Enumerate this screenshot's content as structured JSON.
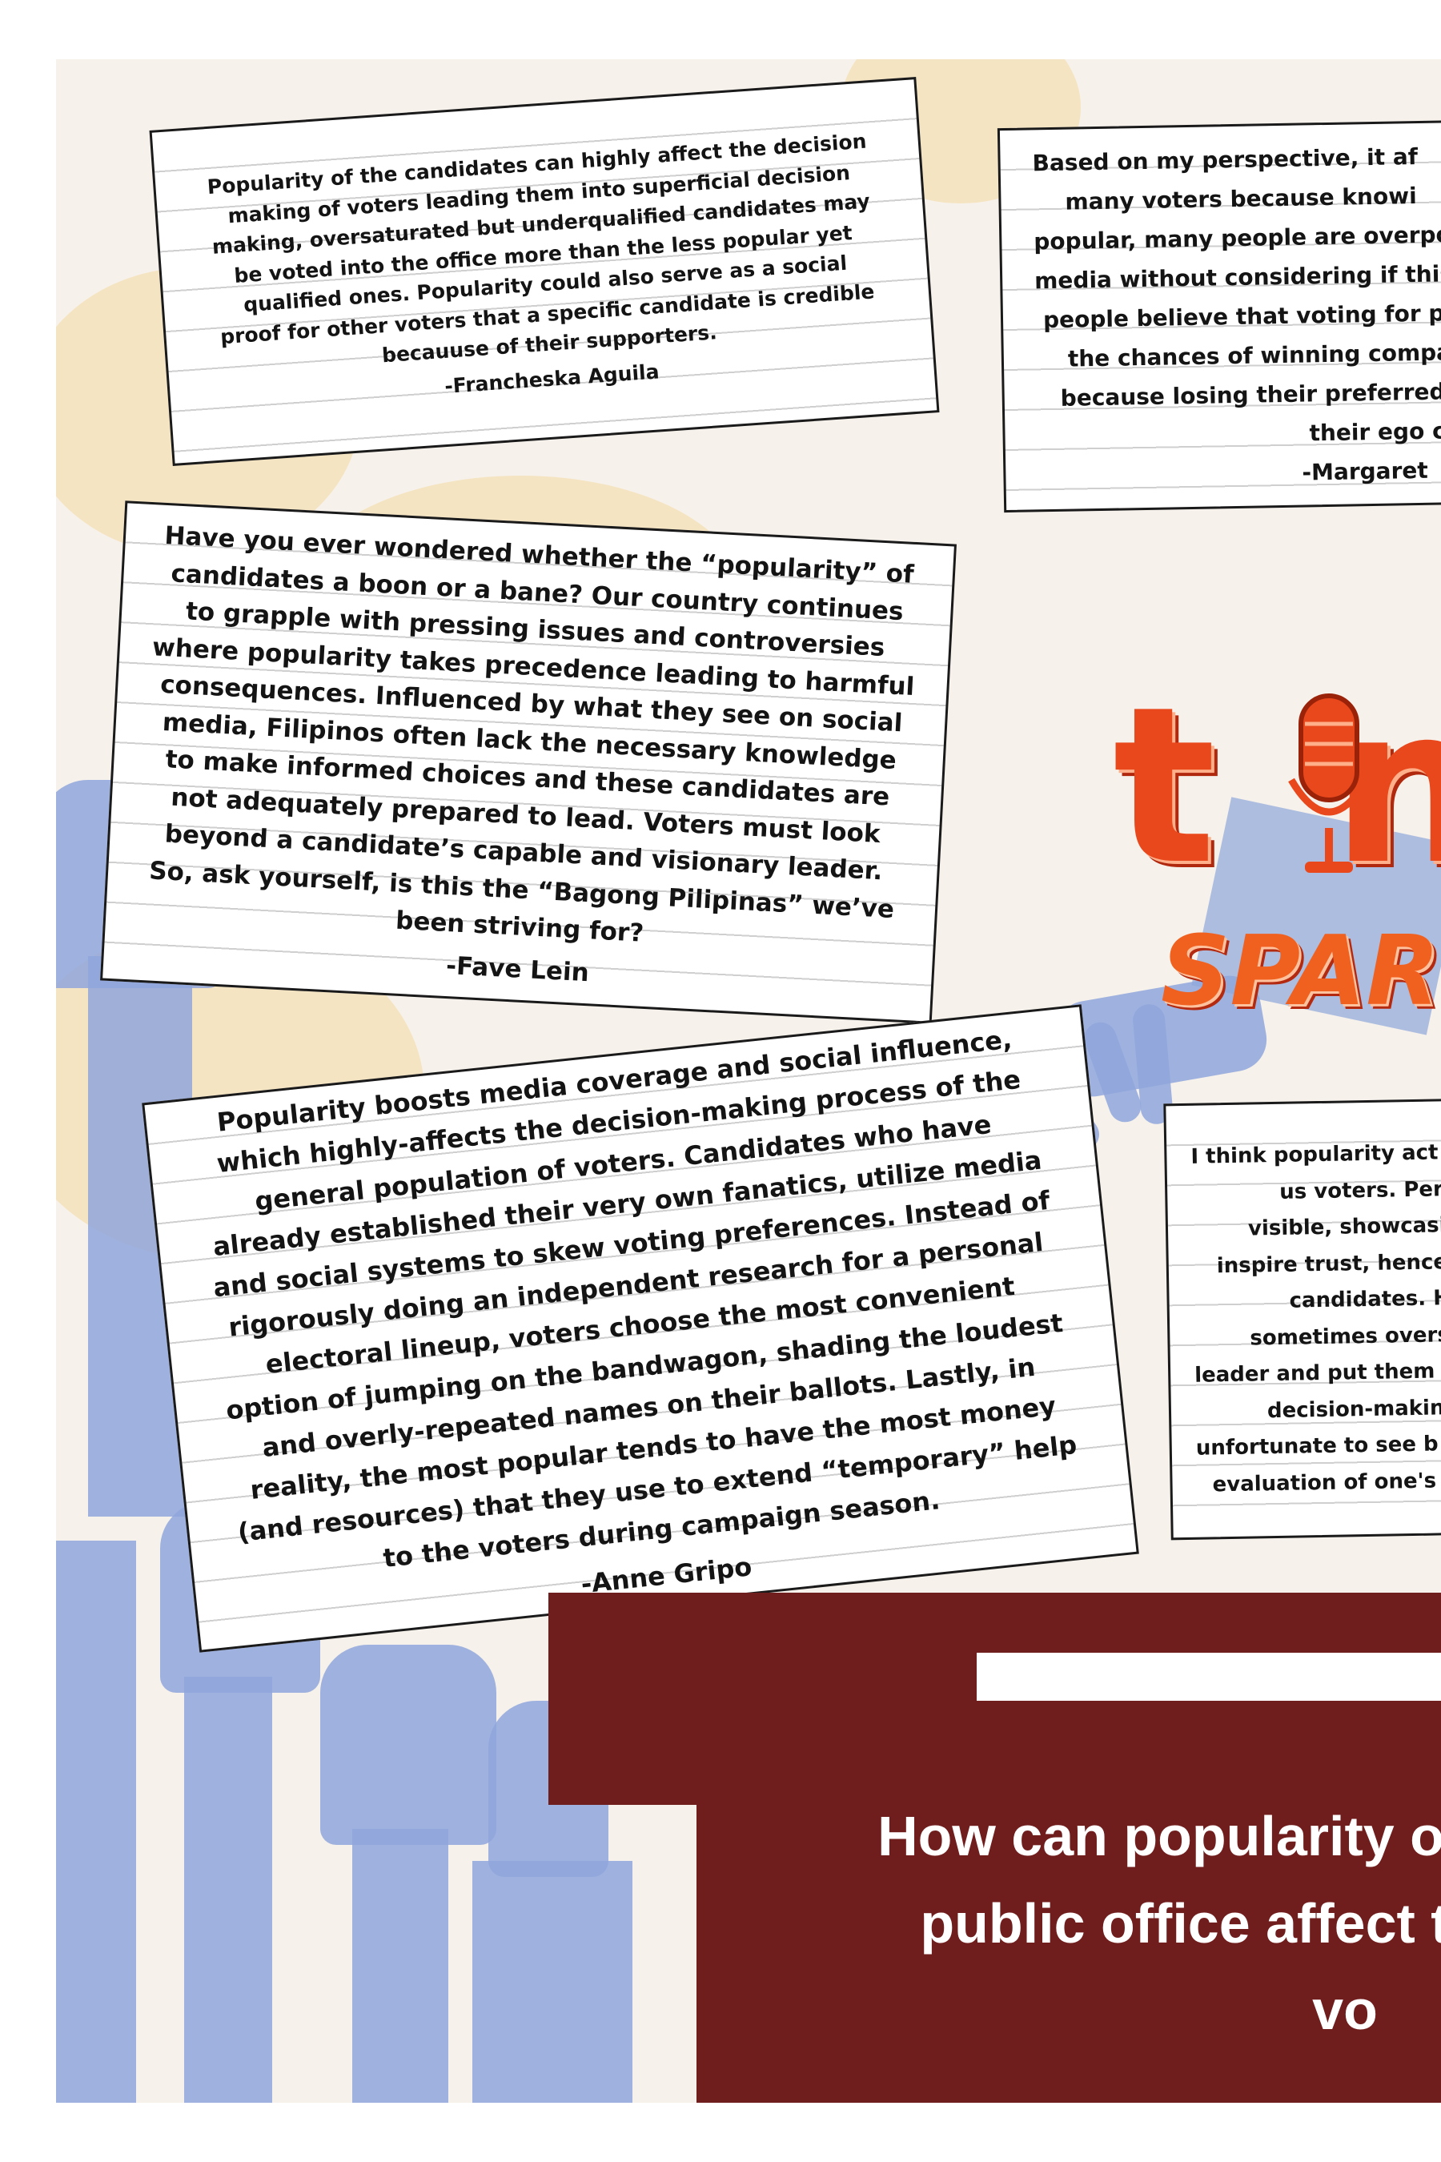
{
  "colors": {
    "background": "#f6f1ea",
    "cloud": "#f5e2bd",
    "hands": "#8fa6dc",
    "banner": "#6f1e1d",
    "logo": "#e8481c"
  },
  "cards": {
    "aguila": {
      "text": "Popularity of the candidates can highly affect the decision making of voters leading them into superficial decision making, oversaturated but underqualified candidates may be voted into the office more than the less popular yet qualified ones. Popularity could also serve as a social proof for other voters that a specific candidate is credible becauuse of their supporters.",
      "author": "-Francheska Aguila"
    },
    "margaret": {
      "lines": [
        "Based on my perspective, it af",
        "many voters because knowi",
        "popular, many people are overpo",
        "media without considering if this",
        "people believe that voting for p",
        "the chances of winning compa",
        "because losing their preferred",
        "their ego c",
        "-Margaret"
      ]
    },
    "lein": {
      "text": "Have you ever wondered whether the “popularity” of candidates a boon or a bane? Our country continues to grapple with pressing issues and controversies where popularity takes precedence leading to harmful consequences. Influenced by what they see on social media, Filipinos often lack the necessary knowledge to make informed choices and these candidates are not adequately prepared to lead. Voters must look beyond a candidate’s capable and visionary leader. So, ask yourself, is this the “Bagong Pilipinas” we’ve been striving for?",
      "author": "-Fave Lein"
    },
    "gripo": {
      "text": "Popularity boosts media coverage and social influence, which highly-affects the decision-making process of the general population of voters. Candidates who have already established their very own fanatics, utilize media and social systems to skew voting preferences. Instead of rigorously doing an independent research for a personal electoral lineup, voters choose the most convenient option of jumping on the bandwagon, shading the loudest and overly-repeated names on their ballots. Lastly, in reality, the most popular tends to have the most money (and resources) that they use to extend “temporary” help to the voters during campaign season.",
      "author": "-Anne Gripo"
    },
    "popular": {
      "lines": [
        "I think popularity act",
        "us voters. Persona",
        "visible, showcasing",
        "inspire trust, hence I",
        "candidates. How",
        "sometimes overst",
        "leader and put them",
        "decision-making p",
        "unfortunate to see b",
        "evaluation of one's"
      ]
    }
  },
  "logo": {
    "word": "t",
    "word_tail": "n",
    "sub": "SPAR",
    "icon": "microphone-icon"
  },
  "banner": {
    "question_lines": [
      "How can popularity o",
      "public office affect t",
      "vo"
    ]
  }
}
